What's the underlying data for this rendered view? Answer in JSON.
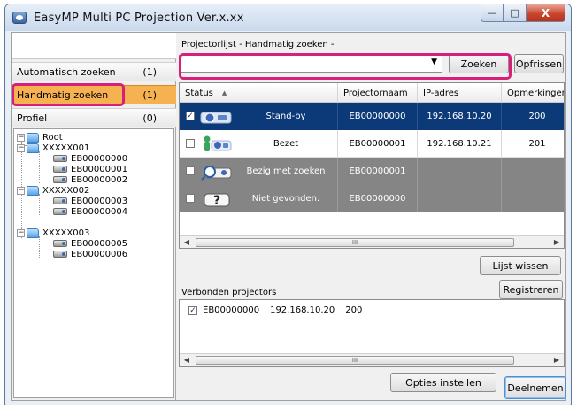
{
  "window": {
    "title": "EasyMP Multi PC Projection Ver.x.xx",
    "min_glyph": "—",
    "max_glyph": "□",
    "close_glyph": "X"
  },
  "nav": {
    "items": [
      {
        "label": "Automatisch zoeken",
        "count": "(1)",
        "selected": false
      },
      {
        "label": "Handmatig zoeken",
        "count": "(1)",
        "selected": true
      },
      {
        "label": "Profiel",
        "count": "(0)",
        "selected": false
      }
    ]
  },
  "tree": {
    "root": "Root",
    "groups": [
      {
        "name": "XXXXX001",
        "items": [
          "EB00000000",
          "EB00000001",
          "EB00000002"
        ]
      },
      {
        "name": "XXXXX002",
        "items": [
          "EB00000003",
          "EB00000004"
        ]
      },
      {
        "name": "XXXXX003",
        "items": [
          "EB00000005",
          "EB00000006"
        ]
      }
    ]
  },
  "search": {
    "section_label": "Projectorlijst - Handmatig zoeken -",
    "combo_value": "",
    "search_button": "Zoeken",
    "clear_button": "Opfrissen"
  },
  "grid": {
    "columns": [
      "Status",
      "Projectornaam",
      "IP-adres",
      "Opmerkingen"
    ],
    "sort_glyph": "▲",
    "rows": [
      {
        "checked": true,
        "status": "Stand-by",
        "name": "EB00000000",
        "ip": "192.168.10.20",
        "notes": "200",
        "style": "selected"
      },
      {
        "checked": false,
        "status": "Bezet",
        "name": "EB00000001",
        "ip": "192.168.10.21",
        "notes": "201",
        "style": "white"
      },
      {
        "checked": false,
        "status": "Bezig met zoeken",
        "name": "EB00000001",
        "ip": "",
        "notes": "",
        "style": "gray"
      },
      {
        "checked": false,
        "status": "Niet gevonden.",
        "name": "EB00000000",
        "ip": "",
        "notes": "",
        "style": "gray"
      }
    ],
    "scroll_grip": "III",
    "clear_list_button": "Lijst wissen"
  },
  "connected": {
    "label": "Verbonden projectors",
    "register_button": "Registreren",
    "rows": [
      {
        "checked": true,
        "name": "EB00000000",
        "ip": "192.168.10.20",
        "notes": "200"
      }
    ],
    "scroll_grip": "III"
  },
  "footer": {
    "options_button": "Opties instellen",
    "join_button": "Deelnemen"
  },
  "colors": {
    "highlight": "#d8207a",
    "selected_nav": "#f6b150",
    "selected_row": "#0c3a78",
    "gray_row": "#858585"
  },
  "check_glyph": "✓",
  "scroll_left_glyph": "◀",
  "scroll_right_glyph": "▶"
}
